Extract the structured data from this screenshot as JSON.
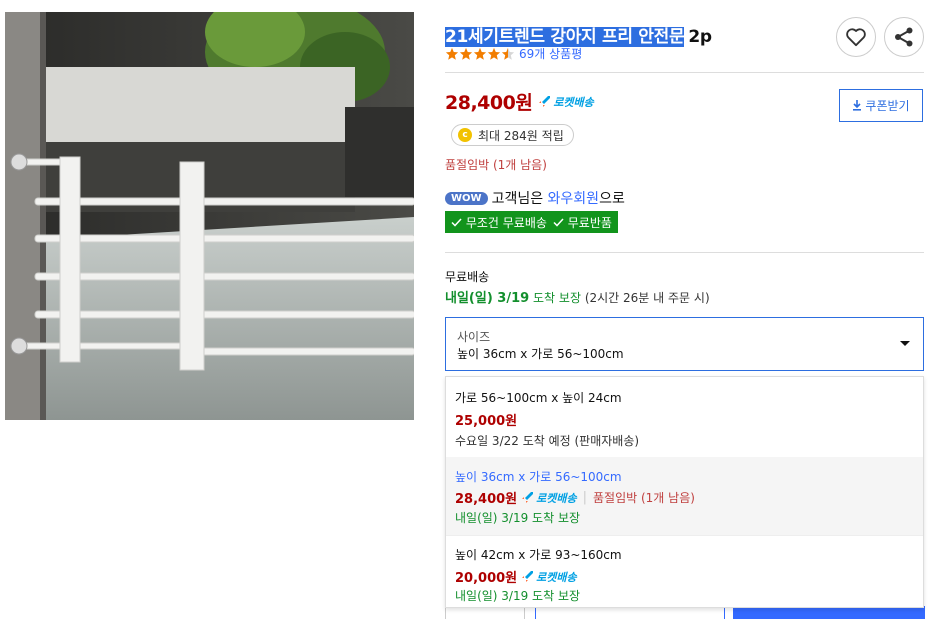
{
  "product": {
    "title_selected": "21세기트렌드 강아지 프리 안전문",
    "title_qty": "2p",
    "rating": 4.5,
    "review_count": "69개 상품평",
    "price": "28,400원",
    "rocket_label": "로켓배송",
    "coupon_button": "쿠폰받기",
    "points": "최대 284원 적립",
    "coin_icon_text": "c",
    "stock": "품절임박 (1개 남음)"
  },
  "wow": {
    "badge": "WOW",
    "text_prefix": "고객님은",
    "link": "와우회원",
    "text_suffix": "으로",
    "tags": [
      "무조건 무료배송",
      "무료반품"
    ]
  },
  "shipping": {
    "label": "무료배송",
    "arrival_main": "내일(일) 3/19",
    "arrival_guarantee": "도착 보장",
    "arrival_note": "(2시간 26분 내 주문 시)"
  },
  "size_select": {
    "label": "사이즈",
    "value": "높이 36cm x 가로 56~100cm"
  },
  "size_options": [
    {
      "name": "가로 56~100cm x 높이 24cm",
      "price": "25,000원",
      "rocket": "",
      "stock": "",
      "arrival": "수요일 3/22 도착 예정 (판매자배송)",
      "active": false
    },
    {
      "name": "높이 36cm x 가로 56~100cm",
      "price": "28,400원",
      "rocket": "로켓배송",
      "stock": "품절임박 (1개 남음)",
      "arrival": "내일(일) 3/19 도착 보장",
      "active": true
    },
    {
      "name": "높이 42cm x 가로 93~160cm",
      "price": "20,000원",
      "rocket": "로켓배송",
      "stock": "",
      "arrival": "내일(일) 3/19 도착 보장",
      "active": false
    }
  ],
  "colors": {
    "price_red": "#ae0000",
    "accent_blue": "#346aff",
    "select_border": "#2d6ee0",
    "green": "#138f2d",
    "free_tag_bg": "#12941c",
    "rocket_blue": "#00a0e3",
    "star_orange": "#f27d00"
  },
  "icons": {
    "heart": "heart-icon",
    "share": "share-icon",
    "download": "download-icon",
    "caret": "caret-down-icon",
    "check": "check-icon",
    "rocket": "rocket-icon",
    "star": "star-icon"
  }
}
